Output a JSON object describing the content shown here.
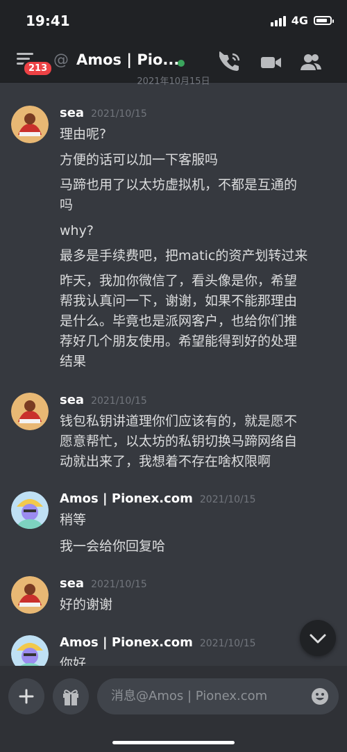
{
  "status": {
    "time": "19:41",
    "network": "4G",
    "battery_percent": 85
  },
  "header": {
    "badge_count": "213",
    "channel_name": "Amos | Pio...",
    "online_color": "#3ba55d"
  },
  "date_divider": "2021年10月15日",
  "messages": [
    {
      "author": "sea",
      "timestamp": "2021/10/15",
      "avatar": "sea-avatar",
      "lines": [
        "理由呢?",
        "方便的话可以加一下客服吗",
        "马蹄也用了以太坊虚拟机，不都是互通的",
        "吗",
        "why?",
        "最多是手续费吧，把matic的资产划转过来",
        "昨天，我加你微信了，看头像是你，希望",
        "帮我认真问一下，谢谢，如果不能那理由",
        "是什么。毕竟也是派网客户，也给你们推",
        "荐好几个朋友使用。希望能得到好的处理",
        "结果"
      ]
    },
    {
      "author": "sea",
      "timestamp": "2021/10/15",
      "avatar": "sea-avatar",
      "lines": [
        "钱包私钥讲道理你们应该有的，就是愿不",
        "愿意帮忙，以太坊的私钥切换马蹄网络自",
        "动就出来了，我想着不存在啥权限啊"
      ]
    },
    {
      "author": "Amos | Pionex.com",
      "timestamp": "2021/10/15",
      "avatar": "amos-avatar",
      "lines": [
        "稍等",
        "我一会给你回复哈"
      ]
    },
    {
      "author": "sea",
      "timestamp": "2021/10/15",
      "avatar": "sea-avatar",
      "lines": [
        "好的谢谢"
      ]
    },
    {
      "author": "Amos | Pionex.com",
      "timestamp": "2021/10/15",
      "avatar": "amos-avatar",
      "lines": [
        "你好"
      ]
    }
  ],
  "composer": {
    "placeholder": "消息@Amos | Pionex.com"
  }
}
